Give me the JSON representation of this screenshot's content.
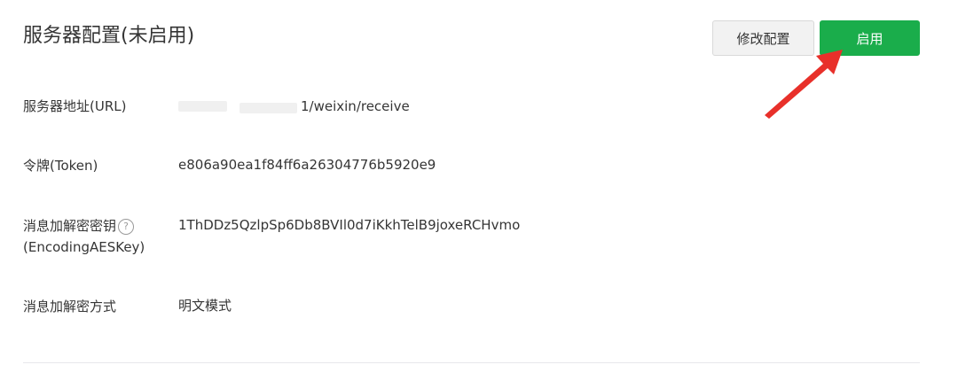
{
  "header": {
    "title": "服务器配置(未启用)",
    "edit_button": "修改配置",
    "enable_button": "启用"
  },
  "fields": {
    "url": {
      "label": "服务器地址(URL)",
      "value": "1/weixin/receive"
    },
    "token": {
      "label": "令牌(Token)",
      "value": "e806a90ea1f84ff6a26304776b5920e9"
    },
    "aes_key": {
      "label_line1": "消息加解密密钥",
      "label_line2": "(EncodingAESKey)",
      "help_icon": "?",
      "value": "1ThDDz5QzlpSp6Db8BVIl0d7iKkhTelB9joxeRCHvmo"
    },
    "encrypt_mode": {
      "label": "消息加解密方式",
      "value": "明文模式"
    }
  },
  "colors": {
    "primary_green": "#1aad4b",
    "annotation_red": "#e8302a"
  },
  "icons": {
    "help": "question-circle-icon",
    "annotation": "red-arrow-icon"
  }
}
